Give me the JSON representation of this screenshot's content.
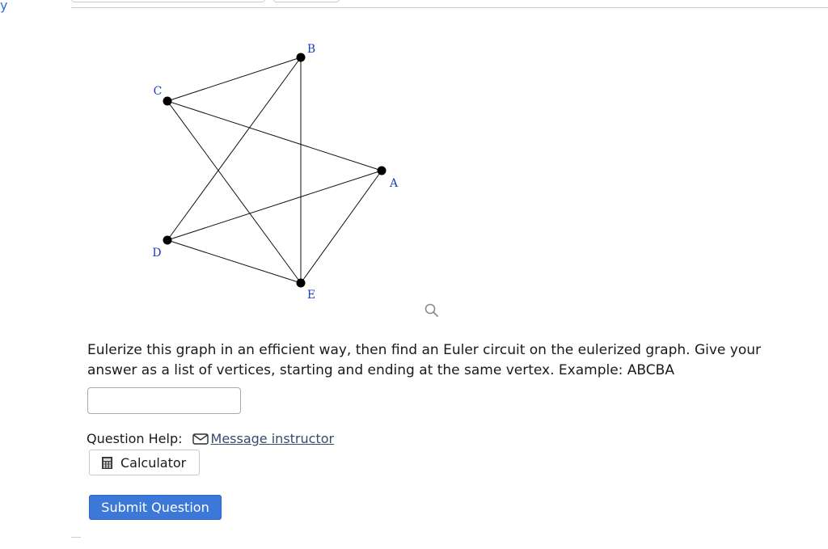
{
  "header": {
    "corner_char": "y"
  },
  "graph": {
    "vertices": [
      {
        "id": "B",
        "label": "B"
      },
      {
        "id": "C",
        "label": "C"
      },
      {
        "id": "A",
        "label": "A"
      },
      {
        "id": "D",
        "label": "D"
      },
      {
        "id": "E",
        "label": "E"
      }
    ],
    "edges": [
      [
        "C",
        "B"
      ],
      [
        "C",
        "A"
      ],
      [
        "C",
        "E"
      ],
      [
        "B",
        "D"
      ],
      [
        "B",
        "E"
      ],
      [
        "A",
        "D"
      ],
      [
        "A",
        "E"
      ],
      [
        "D",
        "E"
      ]
    ],
    "vertex_color": "#000000",
    "label_color": "#1a3fbf"
  },
  "question": {
    "text": "Eulerize this graph in an efficient way, then find an Euler circuit on the eulerized graph. Give your answer as a list of vertices, starting and ending at the same vertex. Example: ABCBA",
    "answer_value": "",
    "answer_placeholder": ""
  },
  "help": {
    "label": "Question Help:",
    "message_link": "Message instructor",
    "calculator_label": "Calculator"
  },
  "actions": {
    "submit_label": "Submit Question",
    "submit_color": "#3b78d8"
  },
  "icons": {
    "zoom": "magnifier-icon",
    "mail": "envelope-icon",
    "calculator": "calculator-icon"
  }
}
